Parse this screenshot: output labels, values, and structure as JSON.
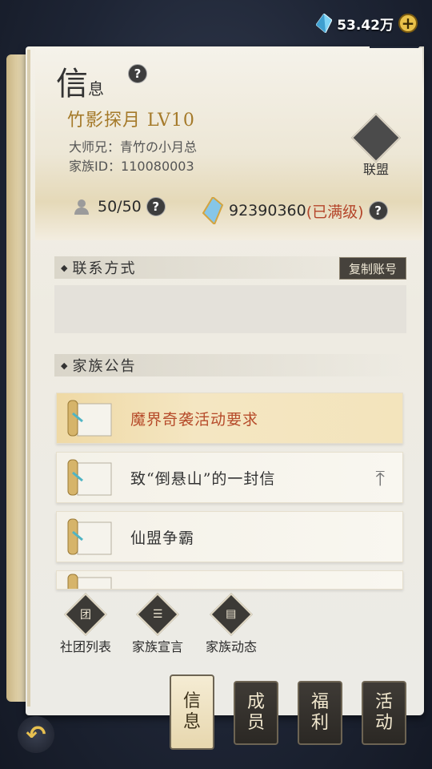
{
  "currency": {
    "value": "53.42万",
    "icon": "crystal-icon",
    "plus_label": "+"
  },
  "header": {
    "title_big": "信",
    "title_small": "息",
    "help_label": "?",
    "clan_name": "竹影探月 LV10",
    "master": "大师兄：青竹の小月总",
    "clan_id": "家族ID：110080003",
    "alliance_label": "联盟",
    "members": "50/50",
    "power": "92390360",
    "power_status": "(已满级)"
  },
  "contact": {
    "title": "联系方式",
    "copy_button": "复制账号",
    "content": ""
  },
  "announcement": {
    "title": "家族公告",
    "items": [
      {
        "text": "魔界奇袭活动要求"
      },
      {
        "text": "致“倒悬山”的一封信"
      },
      {
        "text": "仙盟争霸"
      },
      {
        "text": ""
      }
    ]
  },
  "bottom_icons": [
    {
      "label": "社团列表",
      "glyph": "团"
    },
    {
      "label": "家族宣言",
      "glyph": "☰"
    },
    {
      "label": "家族动态",
      "glyph": "▤"
    }
  ],
  "tabs": [
    {
      "line1": "信",
      "line2": "息"
    },
    {
      "line1": "成",
      "line2": "员"
    },
    {
      "line1": "福",
      "line2": "利"
    },
    {
      "line1": "活",
      "line2": "动"
    }
  ],
  "colors": {
    "accent_gold": "#a57a2a",
    "active_notice_text": "#b64b2a"
  }
}
